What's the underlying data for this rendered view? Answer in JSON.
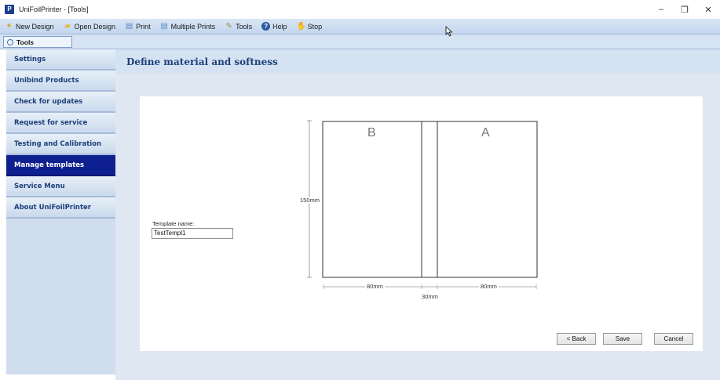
{
  "window": {
    "title": "UniFoilPrinter - [Tools]",
    "app_icon": "P",
    "controls": [
      "–",
      "❐",
      "✕"
    ]
  },
  "toolbar": {
    "items": [
      {
        "label": "New Design",
        "icon": "new-design-icon"
      },
      {
        "label": "Open Design",
        "icon": "folder-open-icon"
      },
      {
        "label": "Print",
        "icon": "print-icon"
      },
      {
        "label": "Multiple Prints",
        "icon": "multiple-print-icon"
      },
      {
        "label": "Tools",
        "icon": "tools-icon"
      },
      {
        "label": "Help",
        "icon": "help-icon"
      },
      {
        "label": "Stop",
        "icon": "stop-hand-icon"
      }
    ]
  },
  "tab": {
    "label": "Tools"
  },
  "sidebar": {
    "items": [
      {
        "label": "Settings",
        "active": false
      },
      {
        "label": "Unibind Products",
        "active": false
      },
      {
        "label": "Check for updates",
        "active": false
      },
      {
        "label": "Request for service",
        "active": false
      },
      {
        "label": "Testing and Calibration",
        "active": false
      },
      {
        "label": "Manage templates",
        "active": true
      },
      {
        "label": "Service Menu",
        "active": false
      },
      {
        "label": "About UniFoilPrinter",
        "active": false
      }
    ]
  },
  "main": {
    "header": "Define material and softness",
    "template_name_label": "Template name:",
    "template_name_value": "TestTempl1",
    "diagram": {
      "left_letter": "B",
      "right_letter": "A",
      "height_label": "150mm",
      "left_width_label": "80mm",
      "spine_width_label": "30mm",
      "right_width_label": "80mm"
    },
    "buttons": {
      "back": "< Back",
      "save": "Save",
      "cancel": "Cancel"
    }
  },
  "colors": {
    "accent": "#0e1f8f",
    "header_text": "#1c3f7a",
    "sidebar_bg": "#cfddee",
    "toolbar_bg": "#c3d6ee"
  }
}
